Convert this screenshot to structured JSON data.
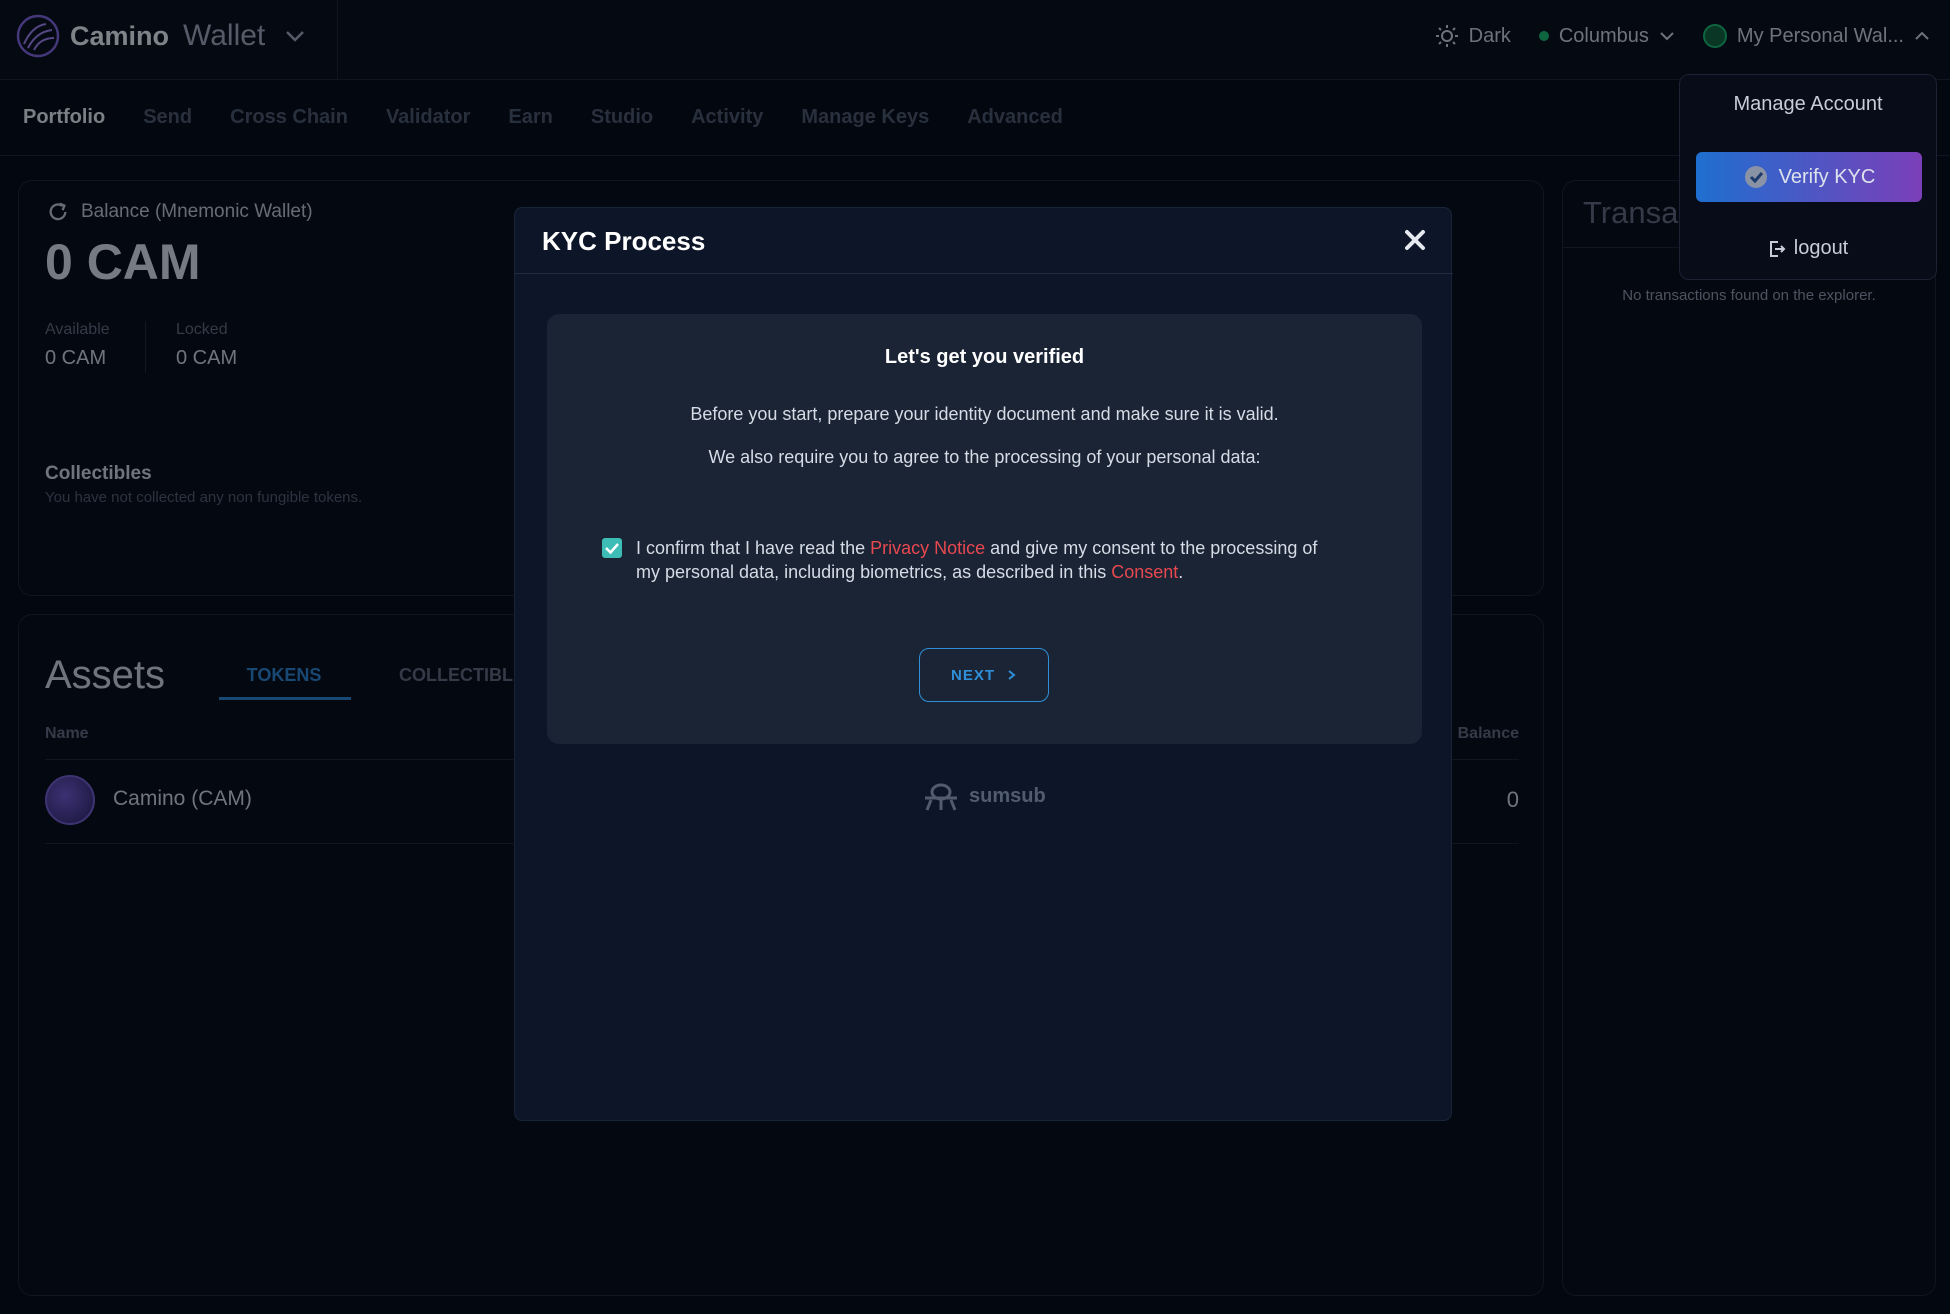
{
  "header": {
    "brand_name": "Camino",
    "brand_product": "Wallet",
    "theme_label": "Dark",
    "network_label": "Columbus",
    "account_label": "My Personal Wal..."
  },
  "nav": {
    "items": [
      "Portfolio",
      "Send",
      "Cross Chain",
      "Validator",
      "Earn",
      "Studio",
      "Activity",
      "Manage Keys",
      "Advanced"
    ],
    "active": "Portfolio"
  },
  "balance_card": {
    "label": "Balance (Mnemonic Wallet)",
    "value": "0 CAM",
    "available_label": "Available",
    "available_value": "0 CAM",
    "locked_label": "Locked",
    "locked_value": "0 CAM",
    "collectibles_title": "Collectibles",
    "collectibles_empty": "You have not collected any non fungible tokens."
  },
  "assets": {
    "title": "Assets",
    "tab_tokens": "TOKENS",
    "tab_collectibles": "COLLECTIBLE",
    "col_name": "Name",
    "col_balance": "Balance",
    "rows": [
      {
        "name": "Camino (CAM)",
        "balance": "0"
      }
    ]
  },
  "transactions": {
    "title": "Transa",
    "empty": "No transactions found on the explorer."
  },
  "account_menu": {
    "manage": "Manage Account",
    "verify": "Verify KYC",
    "logout": "logout"
  },
  "kyc_modal": {
    "title": "KYC Process",
    "heading": "Let's get you verified",
    "para1": "Before you start, prepare your identity document and make sure it is valid.",
    "para2": "We also require you to agree to the processing of your personal data:",
    "consent_pre": "I confirm that I have read the ",
    "consent_link1": "Privacy Notice",
    "consent_mid": " and give my consent to the processing of my personal data, including biometrics, as described in this ",
    "consent_link2": "Consent",
    "consent_end": ".",
    "consent_checked": true,
    "next_label": "NEXT",
    "powered_by": "sumsub"
  },
  "colors": {
    "background": "#050a14",
    "modal": "#0d1628",
    "accent_blue": "#2f8fd8",
    "link_red": "#e8484f",
    "checkbox": "#3dbdb5"
  }
}
